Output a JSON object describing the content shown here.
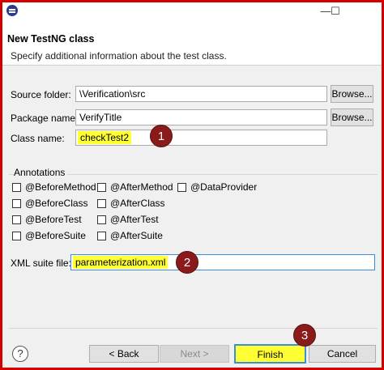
{
  "window": {
    "minimize_glyph": "—",
    "maximize_glyph": "☐"
  },
  "banner": {
    "title": "New TestNG class",
    "subtitle": "Specify additional information about the test class."
  },
  "form": {
    "source_folder": {
      "label": "Source folder:",
      "value": "\\Verification\\src",
      "button": "Browse..."
    },
    "package_name": {
      "label": "Package name:",
      "value": "VerifyTitle",
      "button": "Browse..."
    },
    "class_name": {
      "label": "Class name:",
      "value": "checkTest2"
    }
  },
  "annotations": {
    "title": "Annotations",
    "items": [
      "@BeforeMethod",
      "@AfterMethod",
      "@DataProvider",
      "@BeforeClass",
      "@AfterClass",
      "@BeforeTest",
      "@AfterTest",
      "@BeforeSuite",
      "@AfterSuite"
    ]
  },
  "xml_suite": {
    "label": "XML suite file:",
    "value": "parameterization.xml"
  },
  "markers": [
    "1",
    "2",
    "3"
  ],
  "footer": {
    "help": "?",
    "back": "< Back",
    "next": "Next >",
    "finish": "Finish",
    "cancel": "Cancel"
  },
  "colors": {
    "highlight": "#ffff33",
    "marker": "#8b1a1a",
    "frame": "#d40000"
  }
}
